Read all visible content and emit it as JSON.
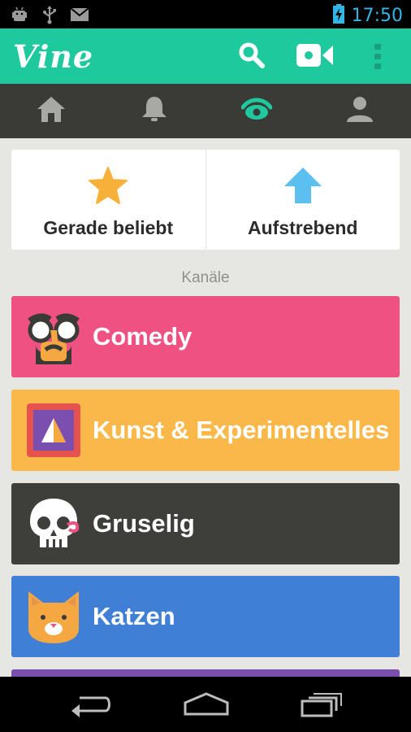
{
  "status_bar": {
    "time": "17:50",
    "icons": [
      "android-debug-icon",
      "usb-icon",
      "gmail-icon",
      "battery-charging-icon"
    ]
  },
  "app_bar": {
    "logo": "Vine",
    "icons": [
      "search-icon",
      "video-camera-icon",
      "overflow-menu-icon"
    ]
  },
  "tabs": [
    {
      "icon": "home-icon",
      "active": false
    },
    {
      "icon": "bell-icon",
      "active": false
    },
    {
      "icon": "eye-icon",
      "active": true
    },
    {
      "icon": "profile-icon",
      "active": false
    }
  ],
  "top_cards": [
    {
      "label": "Gerade beliebt",
      "icon": "star-icon"
    },
    {
      "label": "Aufstrebend",
      "icon": "arrow-up-icon"
    }
  ],
  "section_label": "Kanäle",
  "channels": [
    {
      "label": "Comedy",
      "color": "#ef5282",
      "icon": "groucho-glasses-icon"
    },
    {
      "label": "Kunst & Experimentelles",
      "color": "#fbb84a",
      "icon": "framed-art-icon"
    },
    {
      "label": "Gruselig",
      "color": "#3e3e3a",
      "icon": "skull-icon"
    },
    {
      "label": "Katzen",
      "color": "#3f80d6",
      "icon": "cat-icon"
    }
  ],
  "colors": {
    "accent": "#1fc99e",
    "tab_bar": "#3a3a36",
    "background": "#e6e6e3",
    "next_channel": "#7b4fb0"
  },
  "nav_bar": {
    "icons": [
      "back-icon",
      "home-nav-icon",
      "recents-icon"
    ]
  }
}
